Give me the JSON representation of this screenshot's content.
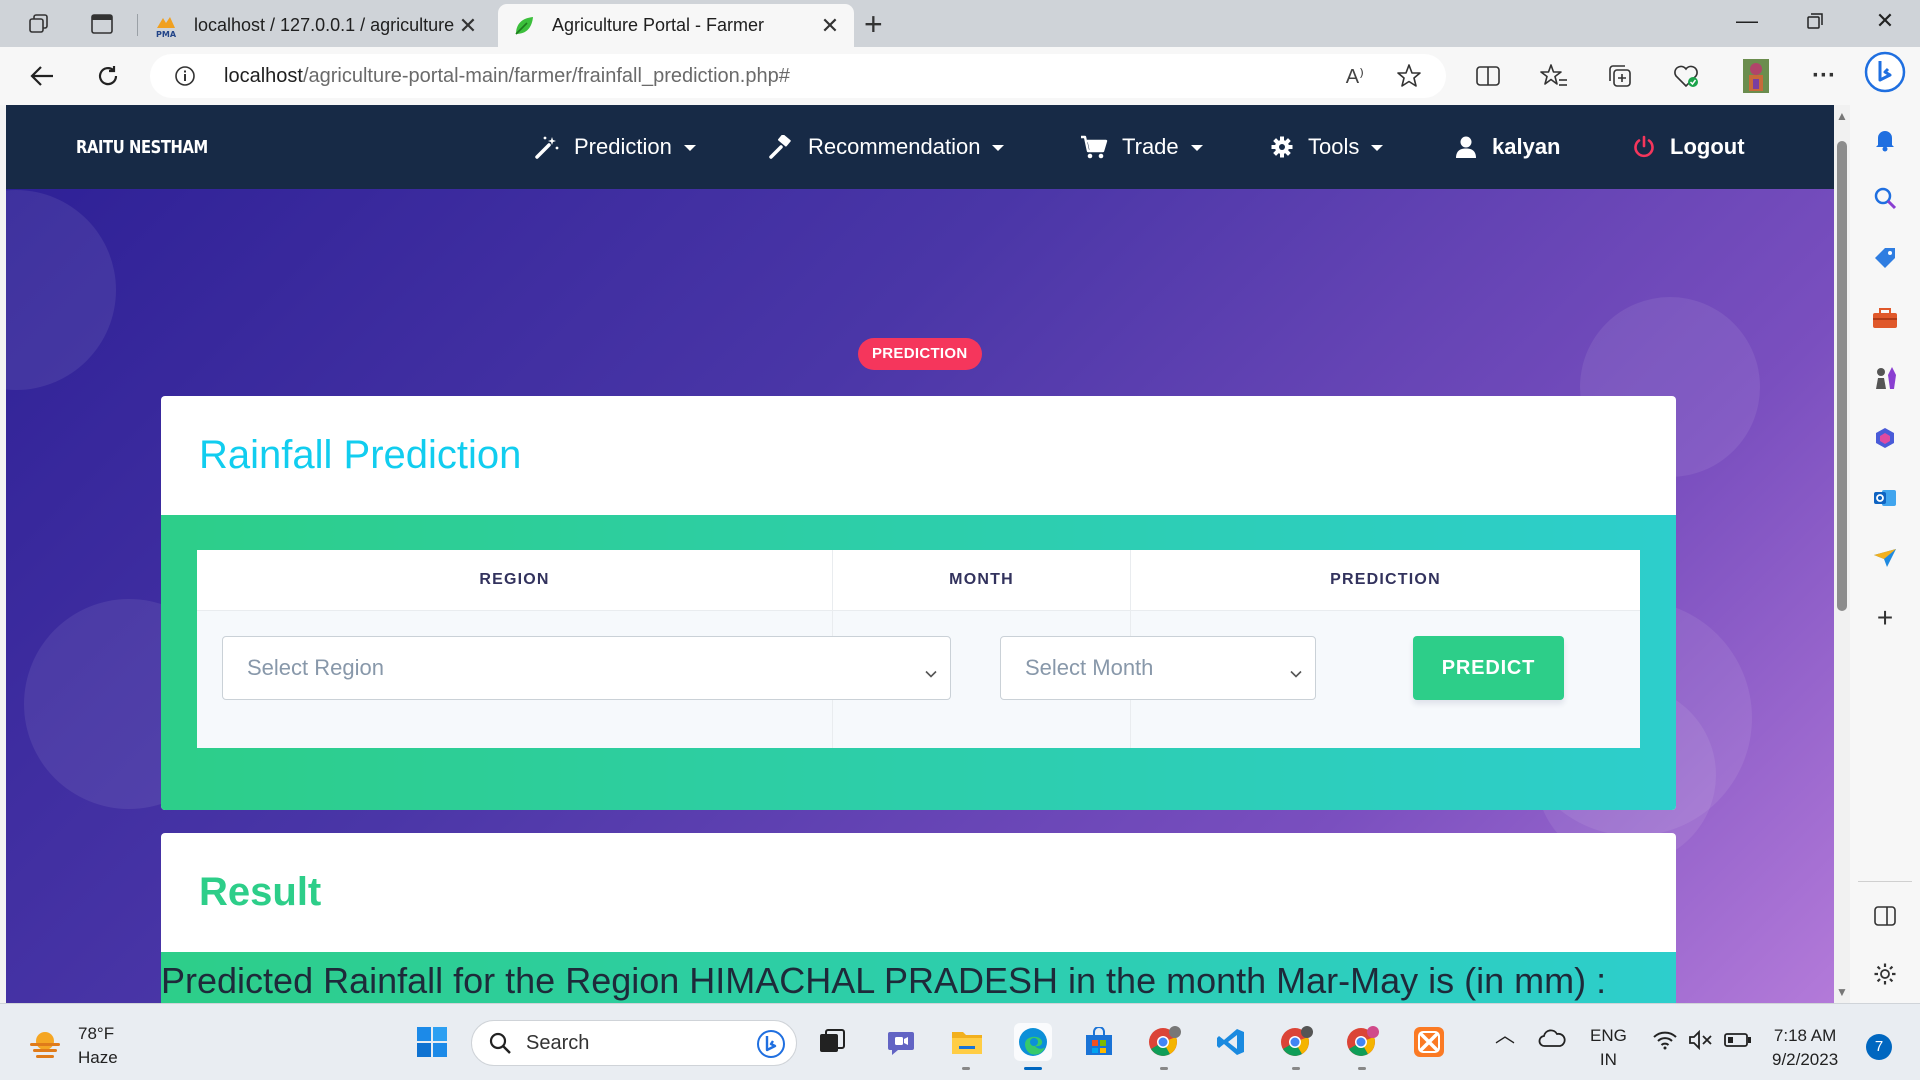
{
  "browser": {
    "tabs": [
      {
        "title": "localhost / 127.0.0.1 / agriculture",
        "favicon": "phpmyadmin-icon"
      },
      {
        "title": "Agriculture Portal - Farmer",
        "favicon": "leaf-icon"
      }
    ],
    "favicon_text": "PMA",
    "url_host": "localhost",
    "url_path": "/agriculture-portal-main/farmer/frainfall_prediction.php#",
    "read_aloud": "A⁾"
  },
  "nav": {
    "brand": "RAITU NESTHAM",
    "items": [
      {
        "label": "Prediction",
        "icon": "magic-wand-icon",
        "dropdown": true
      },
      {
        "label": "Recommendation",
        "icon": "gavel-icon",
        "dropdown": true
      },
      {
        "label": "Trade",
        "icon": "cart-icon",
        "dropdown": true
      },
      {
        "label": "Tools",
        "icon": "gear-icon",
        "dropdown": true
      },
      {
        "label": "kalyan",
        "icon": "user-icon",
        "dropdown": false
      },
      {
        "label": "Logout",
        "icon": "power-icon",
        "dropdown": false
      }
    ]
  },
  "badge": "PREDICTION",
  "form_card": {
    "title": "Rainfall Prediction",
    "columns": [
      "REGION",
      "MONTH",
      "PREDICTION"
    ],
    "region_select": "Select Region",
    "month_select": "Select Month",
    "predict_button": "PREDICT"
  },
  "result_card": {
    "title": "Result",
    "text": "Predicted Rainfall for the Region HIMACHAL PRADESH in the month Mar-May is (in mm) :"
  },
  "taskbar": {
    "temperature": "78°F",
    "condition": "Haze",
    "search_label": "Search",
    "lang_top": "ENG",
    "lang_bottom": "IN",
    "time": "7:18 AM",
    "date": "9/2/2023",
    "notifications": "7"
  },
  "colors": {
    "nav_bg": "#172a46",
    "badge": "#f5365c",
    "title_blue": "#11cdef",
    "green": "#2dce89",
    "teal": "#2dcecc"
  }
}
